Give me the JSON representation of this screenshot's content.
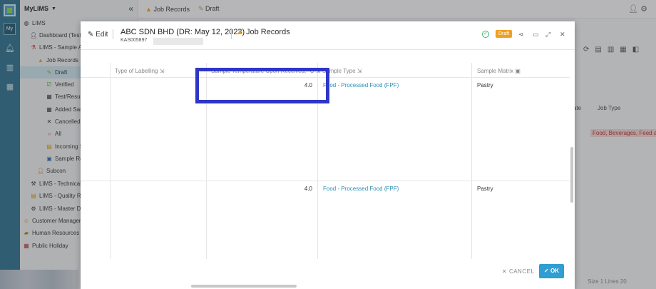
{
  "app": {
    "name": "MyLIMS",
    "rail_badge": "My"
  },
  "topbar": {
    "crumbs": [
      "Job Records",
      "Draft"
    ]
  },
  "sidebar": {
    "items": [
      {
        "label": "LIMS",
        "icon": "globe-icon"
      },
      {
        "label": "Dashboard (Testi",
        "icon": "person-icon"
      },
      {
        "label": "LIMS - Sample Ac",
        "icon": "flask-icon"
      },
      {
        "label": "Job Records",
        "icon": "triangle-icon"
      },
      {
        "label": "Draft",
        "icon": "edit-icon"
      },
      {
        "label": "Verified",
        "icon": "check-icon"
      },
      {
        "label": "Test/Resul",
        "icon": "grid-icon"
      },
      {
        "label": "Added Sam",
        "icon": "grid-icon"
      },
      {
        "label": "Cancelled",
        "icon": "close-icon"
      },
      {
        "label": "All",
        "icon": "circle-icon"
      },
      {
        "label": "Incoming S",
        "icon": "folder-icon"
      },
      {
        "label": "Sample Re",
        "icon": "document-icon"
      },
      {
        "label": "Subcon",
        "icon": "person-icon"
      },
      {
        "label": "LIMS - Technical",
        "icon": "tools-icon"
      },
      {
        "label": "LIMS - Quality Re",
        "icon": "folder-icon"
      },
      {
        "label": "LIMS - Master Da",
        "icon": "gear-icon"
      },
      {
        "label": "Customer Managem",
        "icon": "smiley-icon"
      },
      {
        "label": "Human Resources",
        "icon": "people-icon"
      },
      {
        "label": "Public Holiday",
        "icon": "calendar-icon"
      }
    ]
  },
  "background": {
    "col_date": "ate",
    "col_job_type": "Job Type",
    "tag": "Food, Beverages, Feed ar",
    "pager": "Size 1 Lines 20"
  },
  "modal": {
    "edit_label": "Edit",
    "title": "ABC SDN BHD (DR: May 12, 2023)",
    "subtitle": "KAS005897",
    "records_label": "Job Records",
    "status": "Draft",
    "columns": [
      "Type of Labelling",
      "Sample Temperature Upon Received, °C",
      "Sample Type",
      "Sample Matrix"
    ],
    "rows": [
      {
        "temperature": "4.0",
        "sample_type": "Food - Processed Food (FPF)",
        "sample_matrix": "Pastry"
      },
      {
        "temperature": "4.0",
        "sample_type": "Food - Processed Food (FPF)",
        "sample_matrix": "Pastry"
      }
    ],
    "cancel_label": "CANCEL",
    "ok_label": "OK"
  },
  "colors": {
    "accent": "#2f9ed2",
    "draft": "#f0a020",
    "highlight": "#2e36c8",
    "link": "#2a8fb5"
  }
}
